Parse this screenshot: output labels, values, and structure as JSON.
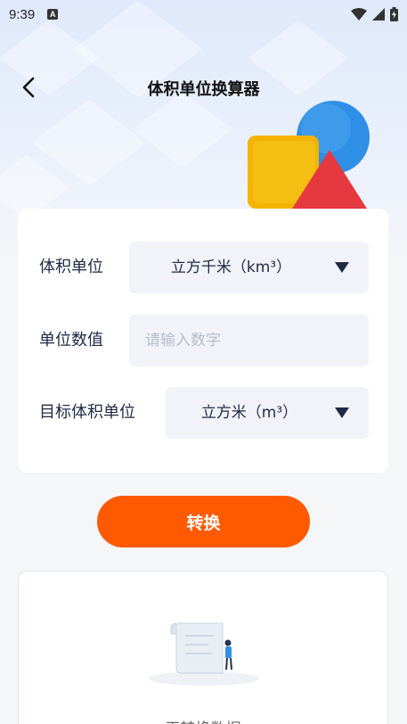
{
  "status_bar": {
    "time": "9:39",
    "notification_icon": "a-icon"
  },
  "header": {
    "title": "体积单位换算器",
    "back_icon": "chevron-left-icon"
  },
  "form": {
    "volume_unit": {
      "label": "体积单位",
      "selected": "立方千米（km³）"
    },
    "unit_value": {
      "label": "单位数值",
      "placeholder": "请输入数字",
      "value": ""
    },
    "target_unit": {
      "label": "目标体积单位",
      "selected": "立方米（m³）"
    }
  },
  "convert_button": {
    "label": "转换"
  },
  "result": {
    "empty_text": "无转换数据"
  },
  "colors": {
    "accent": "#ff5a00",
    "text_primary": "#1f2a44",
    "field_bg": "#f1f3f8",
    "hero_blue": "#2f8fe6",
    "hero_yellow": "#f2b400",
    "hero_red": "#e5393f"
  }
}
